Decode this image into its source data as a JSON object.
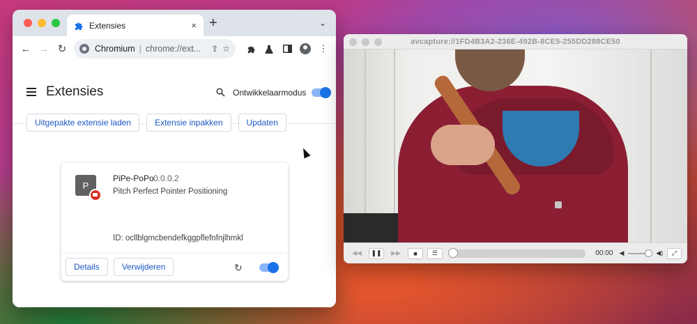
{
  "browser": {
    "tab": {
      "title": "Extensies",
      "close_icon": "×"
    },
    "new_tab_label": "+",
    "tab_dropdown_icon": "⌄",
    "omnibox": {
      "site_name": "Chromium",
      "url": "chrome://ext..."
    }
  },
  "extensions_page": {
    "title": "Extensies",
    "developer_mode_label": "Ontwikkelaarmodus",
    "developer_mode_enabled": true,
    "actions": [
      "Uitgepakte extensie laden",
      "Extensie inpakken",
      "Updaten"
    ],
    "card": {
      "icon_letter": "P",
      "name": "PiPe-PoPo",
      "version": "0.0.0.2",
      "description": "Pitch Perfect Pointer Positioning",
      "id_text": "ID: ocllblgmcbendefkggpflefnfnjlhmkl",
      "details_label": "Details",
      "remove_label": "Verwijderen",
      "enabled": true
    }
  },
  "player": {
    "title": "avcapture://1FD4B3A2-236E-492B-8CE5-255DD288CE50",
    "time": "00:00",
    "progress": 0
  },
  "colors": {
    "accent_blue": "#1a73e8",
    "link_blue": "#1a56c4",
    "hoodie": "#8b1e33"
  }
}
